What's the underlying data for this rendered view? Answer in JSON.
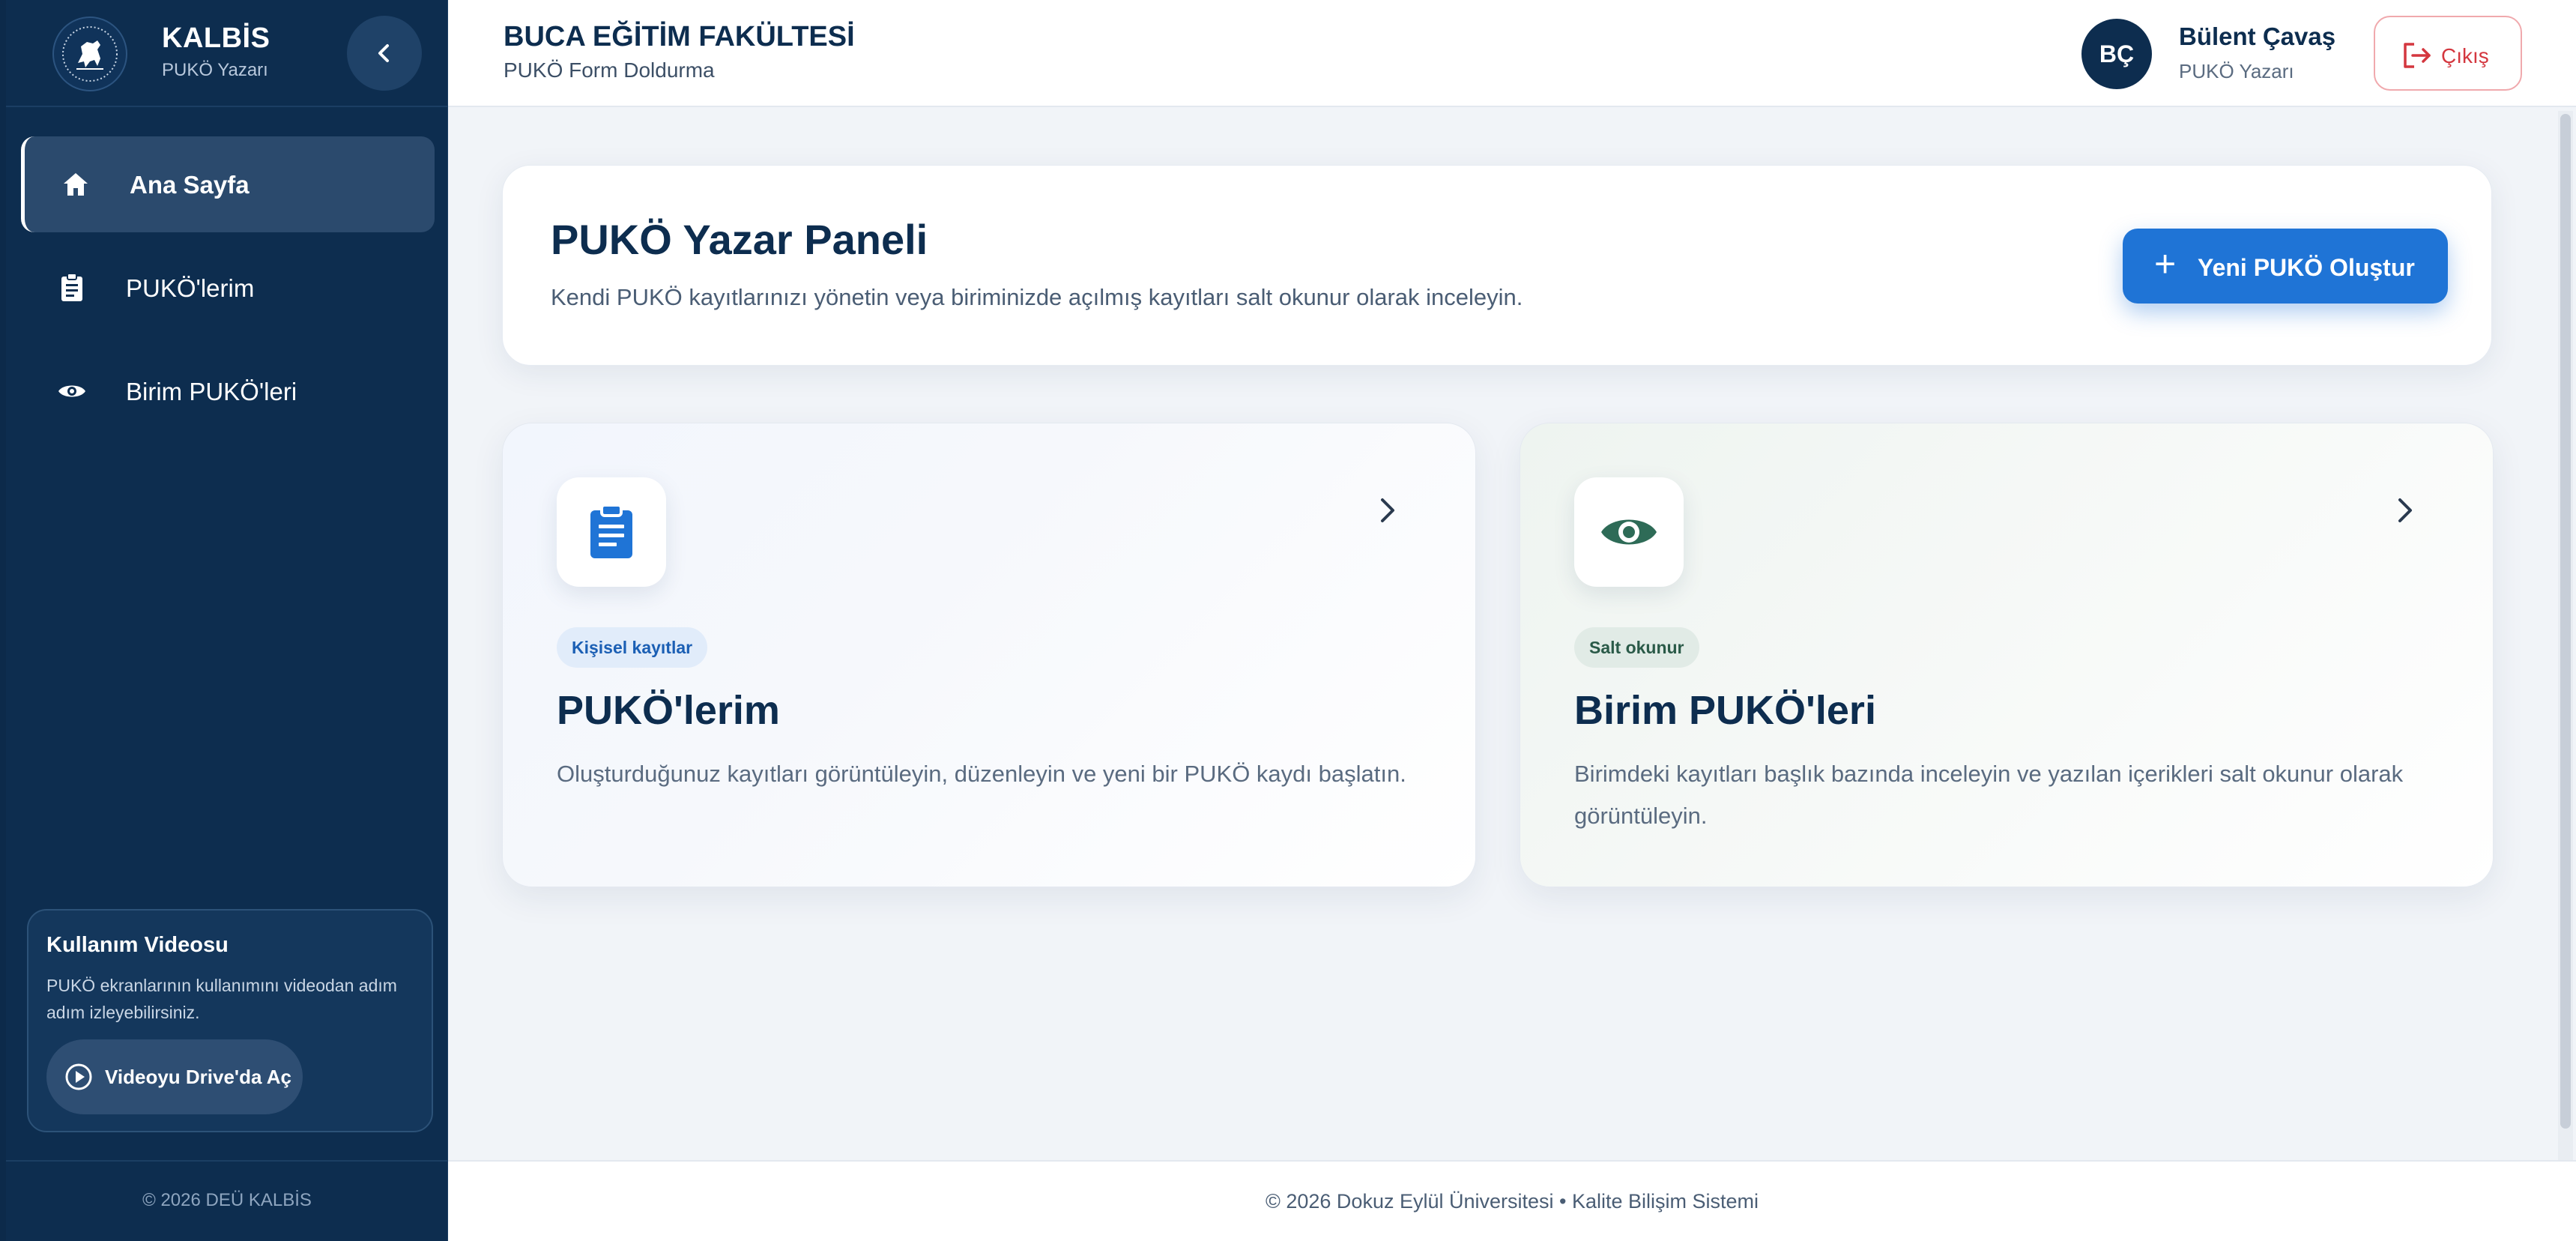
{
  "sidebar": {
    "brand_title": "KALBİS",
    "brand_subtitle": "PUKÖ Yazarı",
    "nav": [
      {
        "label": "Ana Sayfa",
        "icon": "home-icon",
        "active": true
      },
      {
        "label": "PUKÖ'lerim",
        "icon": "clipboard-icon",
        "active": false
      },
      {
        "label": "Birim PUKÖ'leri",
        "icon": "eye-icon",
        "active": false
      }
    ],
    "video": {
      "title": "Kullanım Videosu",
      "description": "PUKÖ ekranlarının kullanımını videodan adım adım izleyebilirsiniz.",
      "button_label": "Videoyu Drive'da Aç"
    },
    "footer": "© 2026 DEÜ KALBİS"
  },
  "header": {
    "faculty": "BUCA EĞİTİM FAKÜLTESİ",
    "subtitle": "PUKÖ Form Doldurma",
    "user": {
      "initials": "BÇ",
      "name": "Bülent Çavaş",
      "role": "PUKÖ Yazarı"
    },
    "logout_label": "Çıkış"
  },
  "hero": {
    "title": "PUKÖ Yazar Paneli",
    "description": "Kendi PUKÖ kayıtlarınızı yönetin veya biriminizde açılmış kayıtları salt okunur olarak inceleyin.",
    "new_button_label": "Yeni PUKÖ Oluştur"
  },
  "cards": [
    {
      "badge": "Kişisel kayıtlar",
      "title": "PUKÖ'lerim",
      "description": "Oluşturduğunuz kayıtları görüntüleyin, düzenleyin ve yeni bir PUKÖ kaydı başlatın.",
      "icon": "clipboard-icon"
    },
    {
      "badge": "Salt okunur",
      "title": "Birim PUKÖ'leri",
      "description": "Birimdeki kayıtları başlık bazında inceleyin ve yazılan içerikleri salt okunur olarak görüntüleyin.",
      "icon": "eye-icon"
    }
  ],
  "footer": "© 2026 Dokuz Eylül Üniversitesi • Kalite Bilişim Sistemi",
  "colors": {
    "sidebar_bg": "#0d2d4f",
    "primary": "#1f74d6",
    "danger": "#d4373f",
    "eye_green": "#2e6b57"
  }
}
